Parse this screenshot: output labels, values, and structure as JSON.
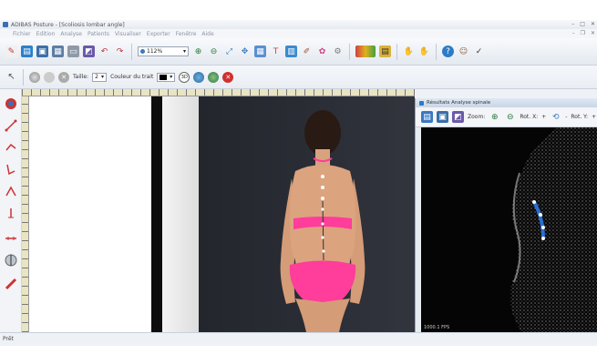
{
  "window": {
    "title": "ADIBAS Posture - [Scoliosis lombar angle]"
  },
  "menu": [
    "Fichier",
    "Edition",
    "Analyse",
    "Patients",
    "Visualiser",
    "Exporter",
    "Fenêtre",
    "Aide"
  ],
  "toolbar": {
    "zoom_value": "112%"
  },
  "style_bar": {
    "size_label": "Taille:",
    "size_value": "2",
    "color_label": "Couleur du trait"
  },
  "panel": {
    "title": "Résultats Analyse spinale",
    "zoom_label": "Zoom:",
    "rot_x_label": "Rot. X:",
    "rot_y_label": "Rot. Y:",
    "fps": "1000.1 FPS"
  },
  "status": {
    "text": "Prêt"
  },
  "colors": {
    "accent": "#2c7bc6",
    "wall": "#2b2e36",
    "swimsuit": "#ff3d9a",
    "spine_markers": "#2a6fd0"
  },
  "icons": [
    "new-icon",
    "open-icon",
    "save-icon",
    "save-as-icon",
    "print-icon",
    "capture-icon",
    "undo-icon",
    "redo-icon",
    "zoom-in-icon",
    "zoom-out-icon",
    "fit-icon",
    "move-icon",
    "grid-icon",
    "info-icon",
    "calendar-icon",
    "brush-icon",
    "palette-icon",
    "settings-icon",
    "help-icon",
    "user-icon"
  ]
}
